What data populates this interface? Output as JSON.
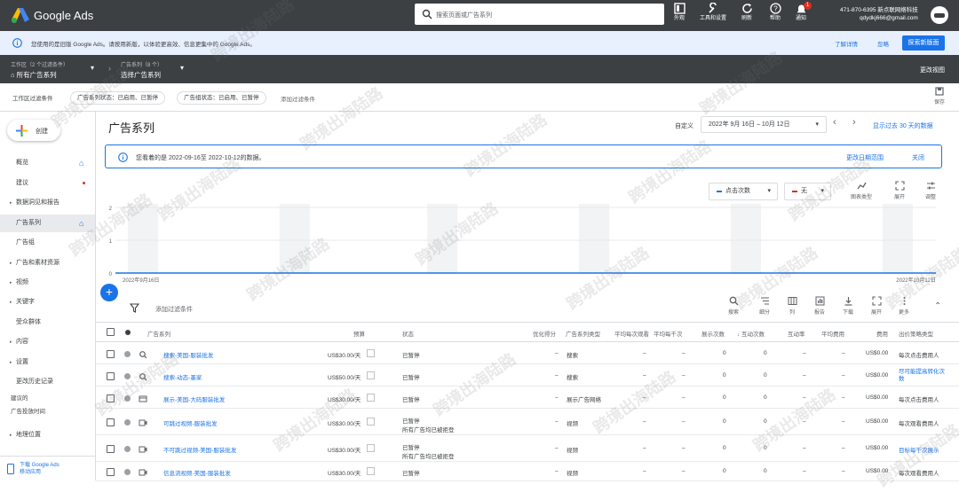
{
  "topbar": {
    "brand": "Google Ads",
    "search_placeholder": "搜索页面或广告系列",
    "buttons": [
      {
        "icon": "appearance-icon",
        "label": "外观"
      },
      {
        "icon": "wrench-icon",
        "label": "工具和设置"
      },
      {
        "icon": "refresh-icon",
        "label": "刷新"
      },
      {
        "icon": "help-icon",
        "label": "帮助"
      },
      {
        "icon": "bell-icon",
        "label": "通知",
        "badge": "1"
      }
    ],
    "account_id": "471-870-6395 新点联网络科技",
    "account_email": "qdydkj666@gmail.com"
  },
  "notice": {
    "text": "您使用的是旧版 Google Ads。请按用新版，以体验更高效、信息更集中的 Google Ads。",
    "learn_more": "了解详情",
    "ignore": "忽略",
    "explore": "探索新版面"
  },
  "crumb": {
    "workspace_small": "工作区（2 个过滤条件）",
    "workspace_label": "所有广告系列",
    "campaign_small": "广告系列（8 个）",
    "campaign_label": "选择广告系列",
    "change_view": "更改视图"
  },
  "filterbar": {
    "label": "工作区过滤条件",
    "chip1": "广告系列状态：已启用、已暂停",
    "chip2": "广告组状态：已启用、已暂停",
    "add": "添加过滤条件",
    "save": "保存"
  },
  "sidebar": {
    "create": "创建",
    "items": [
      {
        "label": "概览",
        "arrow": ""
      },
      {
        "label": "建议",
        "arrow": ""
      },
      {
        "label": "数据洞见和报告",
        "arrow": "▸"
      },
      {
        "label": "广告系列",
        "arrow": ""
      },
      {
        "label": "广告组",
        "arrow": ""
      },
      {
        "label": "广告和素材资源",
        "arrow": "▸"
      },
      {
        "label": "视频",
        "arrow": "▸"
      },
      {
        "label": "关键字",
        "arrow": "▸"
      },
      {
        "label": "受众群体",
        "arrow": ""
      },
      {
        "label": "内容",
        "arrow": "▸"
      },
      {
        "label": "设置",
        "arrow": "▸"
      },
      {
        "label": "更改历史记录",
        "arrow": ""
      },
      {
        "label": "建议的",
        "arrow": ""
      },
      {
        "label": "广告投放时间",
        "arrow": ""
      },
      {
        "label": "地理位置",
        "arrow": "▸"
      }
    ],
    "mobile_app": "下载 Google Ads\n移动应用"
  },
  "main": {
    "title": "广告系列",
    "custom": "自定义",
    "date": "2022年 9月 16日 – 10月 12日",
    "show_last": "显示过去 30 天的数据",
    "info_text": "您看着的是 2022-09-16至 2022-10-12的数据。",
    "change_range": "更改日期范围",
    "close": "关闭"
  },
  "chart_data": {
    "type": "line",
    "metric1": "点击次数",
    "metric2": "无",
    "x_start": "2022年9月16日",
    "x_end": "2022年10月12日",
    "y_ticks": [
      "2",
      "1",
      "0"
    ],
    "ylim": [
      0,
      2
    ],
    "values": [
      0,
      0,
      0,
      0,
      0,
      0,
      0,
      0,
      0,
      0,
      0,
      0,
      0,
      0,
      0,
      0,
      0,
      0,
      0,
      0,
      0,
      0,
      0,
      0,
      0,
      0,
      0
    ],
    "shaded_weekends": [
      0.015,
      0.2,
      0.38,
      0.565,
      0.75,
      0.935
    ],
    "tools": [
      "图表类型",
      "展开",
      "调整"
    ]
  },
  "table_tools": {
    "filter": "添加过滤条件",
    "items": [
      {
        "icon": "search-icon",
        "label": "搜索"
      },
      {
        "icon": "segment-icon",
        "label": "细分"
      },
      {
        "icon": "columns-icon",
        "label": "列"
      },
      {
        "icon": "report-icon",
        "label": "报告"
      },
      {
        "icon": "download-icon",
        "label": "下载"
      },
      {
        "icon": "expand-icon",
        "label": "展开"
      },
      {
        "icon": "more-icon",
        "label": "更多"
      }
    ]
  },
  "table": {
    "headers": [
      "广告系列",
      "预算",
      "状态",
      "优化得分",
      "广告系列类型",
      "平均每次观看",
      "平均每千次",
      "展示次数",
      "↓ 互动次数",
      "互动率",
      "平均费用",
      "费用",
      "出价策略类型"
    ],
    "rows": [
      {
        "icon": "search",
        "name": "搜索-美国-服装批发",
        "budget": "US$30.00/天",
        "status": "已暂停",
        "status2": "",
        "score": "–",
        "type": "搜索",
        "c1": "–",
        "c2": "–",
        "impr": "0",
        "inter": "0",
        "rate": "–",
        "avg": "–",
        "cost": "US$0.00",
        "bid": "每次点击费用人"
      },
      {
        "icon": "search",
        "name": "搜索-动态-墨家",
        "budget": "US$50.00/天",
        "status": "已暂停",
        "status2": "",
        "score": "–",
        "type": "搜索",
        "c1": "–",
        "c2": "–",
        "impr": "0",
        "inter": "0",
        "rate": "–",
        "avg": "–",
        "cost": "US$0.00",
        "bid": "尽可能提高转化次数"
      },
      {
        "icon": "display",
        "name": "展示-美国-大码服装批发",
        "budget": "US$30.00/天",
        "status": "已暂停",
        "status2": "",
        "score": "–",
        "type": "展示广告网络",
        "c1": "–",
        "c2": "–",
        "impr": "0",
        "inter": "0",
        "rate": "–",
        "avg": "–",
        "cost": "US$0.00",
        "bid": "每次点击费用人"
      },
      {
        "icon": "video",
        "name": "可跳过视频-服装批发",
        "budget": "US$30.00/天",
        "status": "已暂停",
        "status2": "所有广告均已被拒登",
        "score": "–",
        "type": "视频",
        "c1": "–",
        "c2": "–",
        "impr": "0",
        "inter": "0",
        "rate": "–",
        "avg": "–",
        "cost": "US$0.00",
        "bid": "每次观看费用人"
      },
      {
        "icon": "video",
        "name": "不可跳过视频-美国-服装批发",
        "budget": "US$30.00/天",
        "status": "已暂停",
        "status2": "所有广告均已被拒登",
        "score": "–",
        "type": "视频",
        "c1": "–",
        "c2": "–",
        "impr": "0",
        "inter": "0",
        "rate": "–",
        "avg": "–",
        "cost": "US$0.00",
        "bid": "目标每千次展示"
      },
      {
        "icon": "video",
        "name": "信息流视频-美国-服装批发",
        "budget": "US$30.00/天",
        "status": "已暂停",
        "status2": "",
        "score": "–",
        "type": "视频",
        "c1": "–",
        "c2": "–",
        "impr": "0",
        "inter": "0",
        "rate": "–",
        "avg": "–",
        "cost": "US$0.00",
        "bid": "每次观看费用人"
      }
    ]
  },
  "watermark": "跨境出海陆路"
}
